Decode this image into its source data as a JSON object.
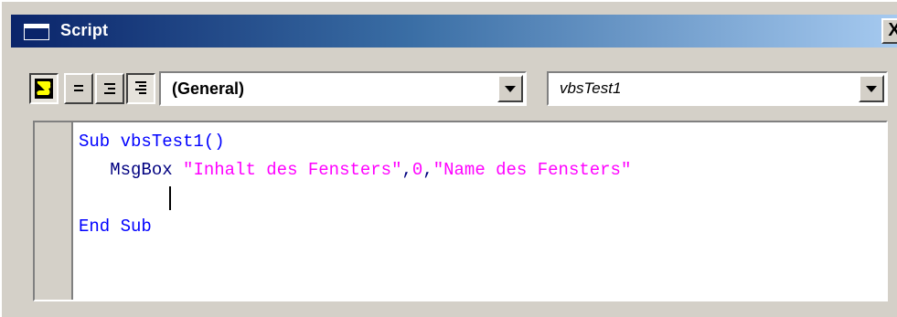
{
  "window": {
    "title": "Script",
    "close_label": "X"
  },
  "toolbar": {
    "buttons": [
      {
        "name": "script-view-icon",
        "pressed": true
      },
      {
        "name": "align-left-icon",
        "pressed": false
      },
      {
        "name": "align-right-icon",
        "pressed": false
      },
      {
        "name": "justify-icon",
        "pressed": true
      }
    ]
  },
  "object_combo": {
    "value": "(General)"
  },
  "procedure_combo": {
    "value": "vbsTest1"
  },
  "editor": {
    "lines": [
      {
        "keyword": "Sub",
        "rest": " vbsTest1()"
      },
      {
        "indent": "   ",
        "func": "MsgBox",
        "string1": "\"Inhalt des Fensters\"",
        "sep1": ",",
        "num": "0",
        "sep2": ",",
        "string2": "\"Name des Fensters\""
      },
      {
        "empty": ""
      },
      {
        "keyword": "End Sub"
      }
    ]
  },
  "colors": {
    "keyword": "#0000ff",
    "identifier": "#000080",
    "string": "#ff00ff",
    "titlebar_start": "#0a246a",
    "titlebar_end": "#a6caf0",
    "face": "#d4d0c8"
  }
}
